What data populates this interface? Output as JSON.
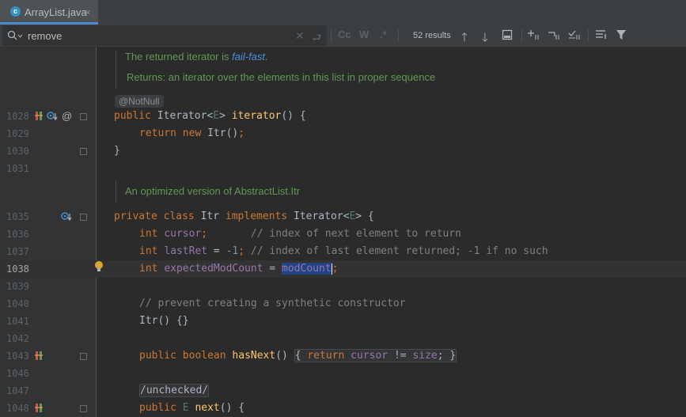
{
  "tab": {
    "label": "ArrayList.java",
    "icon": "class-c-icon",
    "close": "×"
  },
  "search": {
    "value": "remove",
    "results": "52 results",
    "case_btn": "Cc",
    "word_btn": "W",
    "regex_btn": ".*"
  },
  "doc1": {
    "prefix": "The returned iterator is ",
    "link": "fail-fast",
    "suffix": "."
  },
  "doc2": "Returns: an iterator over the elements in this list in proper sequence",
  "doc3": "An optimized version of AbstractList.Itr",
  "annotation": "@NotNull",
  "lines": {
    "l1028": "1028",
    "l1029": "1029",
    "l1030": "1030",
    "l1031": "1031",
    "l1035": "1035",
    "l1036": "1036",
    "l1037": "1037",
    "l1038": "1038",
    "l1039": "1039",
    "l1040": "1040",
    "l1041": "1041",
    "l1042": "1042",
    "l1043": "1043",
    "l1046": "1046",
    "l1047": "1047",
    "l1048": "1048"
  },
  "code": {
    "c1028": {
      "kw": "public ",
      "pre": "Iterator<",
      "tp": "E",
      "post": "> ",
      "fn": "iterator",
      "rest": "() {"
    },
    "c1029": {
      "kw1": "return ",
      "kw2": "new ",
      "rest": "Itr()",
      "semi": ";"
    },
    "c1030": "}",
    "c1035": {
      "kw1": "private ",
      "kw2": "class ",
      "name": "Itr ",
      "kw3": "implements ",
      "pre": "Iterator<",
      "tp": "E",
      "post": "> {"
    },
    "c1036": {
      "kw": "int ",
      "fld": "cursor",
      "semi": ";",
      "cm": "       // index of next element to return"
    },
    "c1037": {
      "kw": "int ",
      "fld": "lastRet",
      "eq": " = ",
      "num": "-1",
      "semi": "; ",
      "cm": "// index of last element returned; -1 if no such"
    },
    "c1038": {
      "kw": "int ",
      "fld": "expectedModCount",
      "eq": " = ",
      "sel": "modCount",
      "semi": ";"
    },
    "c1040": "// prevent creating a synthetic constructor",
    "c1041": "Itr() {}",
    "c1043": {
      "kw1": "public ",
      "kw2": "boolean ",
      "fn": "hasNext",
      "paren": "() ",
      "open": "{ ",
      "kw3": "return ",
      "fld1": "cursor",
      "op": " != ",
      "fld2": "size",
      "close": "; }"
    },
    "c1047": "/unchecked/",
    "c1048": {
      "kw": "public ",
      "tp": "E ",
      "fn": "next",
      "rest": "() {"
    }
  }
}
